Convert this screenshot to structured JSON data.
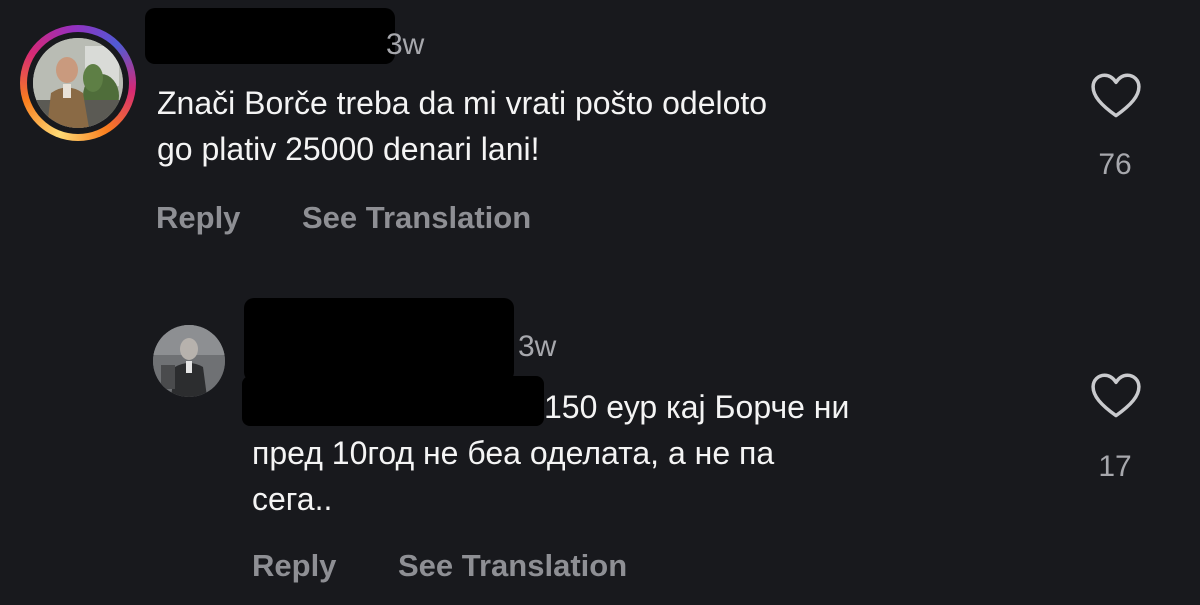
{
  "comments": [
    {
      "username": "",
      "time": "3w",
      "text": "Znači Borče treba da mi vrati pošto odeloto\ngo plativ 25000 denari lani!",
      "likes": "76",
      "reply_label": "Reply",
      "translate_label": "See Translation"
    },
    {
      "username": "",
      "time": "3w",
      "text": "150 еур кај Борче ни\nпред 10год не беа оделата, а не па\nсега..",
      "likes": "17",
      "reply_label": "Reply",
      "translate_label": "See Translation"
    }
  ],
  "icons": {
    "like": "heart-icon"
  },
  "colors": {
    "background": "#18191d",
    "text": "#f4f4f4",
    "muted": "#8e8f94"
  }
}
